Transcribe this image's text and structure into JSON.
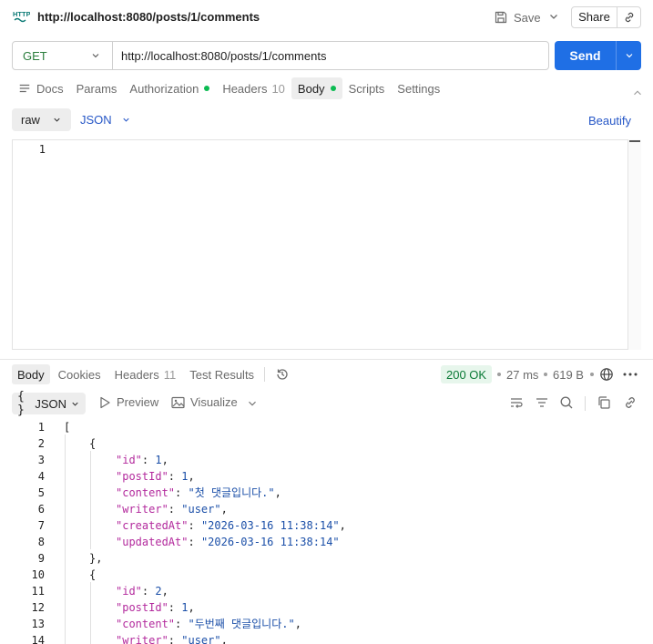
{
  "header": {
    "icon_label": "HTTP",
    "title": "http://localhost:8080/posts/1/comments",
    "save_label": "Save",
    "share_label": "Share"
  },
  "request": {
    "method": "GET",
    "url": "http://localhost:8080/posts/1/comments",
    "send_label": "Send",
    "tabs": [
      {
        "label": "Docs"
      },
      {
        "label": "Params"
      },
      {
        "label": "Authorization"
      },
      {
        "label": "Headers",
        "count": "10"
      },
      {
        "label": "Body"
      },
      {
        "label": "Scripts"
      },
      {
        "label": "Settings"
      }
    ],
    "body_mode": "raw",
    "body_format": "JSON",
    "beautify_label": "Beautify",
    "editor_line_number": "1"
  },
  "response": {
    "tabs": [
      {
        "label": "Body"
      },
      {
        "label": "Cookies"
      },
      {
        "label": "Headers",
        "count": "11"
      },
      {
        "label": "Test Results"
      }
    ],
    "status": "200 OK",
    "time": "27 ms",
    "size": "619 B",
    "format": "JSON",
    "format_icon": "{ }",
    "preview_label": "Preview",
    "visualize_label": "Visualize",
    "line_numbers": [
      "1",
      "2",
      "3",
      "4",
      "5",
      "6",
      "7",
      "8",
      "9",
      "10",
      "11",
      "12",
      "13",
      "14"
    ],
    "code": {
      "open_bracket": "[",
      "open_brace": "{",
      "close_brace_comma": "},",
      "entries": [
        {
          "id_key": "\"id\"",
          "id_val": "1",
          "postId_key": "\"postId\"",
          "postId_val": "1",
          "content_key": "\"content\"",
          "content_val": "\"첫 댓글입니다.\"",
          "writer_key": "\"writer\"",
          "writer_val": "\"user\"",
          "createdAt_key": "\"createdAt\"",
          "createdAt_val": "\"2026-03-16 11:38:14\"",
          "updatedAt_key": "\"updatedAt\"",
          "updatedAt_val": "\"2026-03-16 11:38:14\""
        },
        {
          "id_key": "\"id\"",
          "id_val": "2",
          "postId_key": "\"postId\"",
          "postId_val": "1",
          "content_key": "\"content\"",
          "content_val": "\"두번째 댓글입니다.\"",
          "writer_key": "\"writer\"",
          "writer_val": "\"user\""
        }
      ]
    }
  }
}
